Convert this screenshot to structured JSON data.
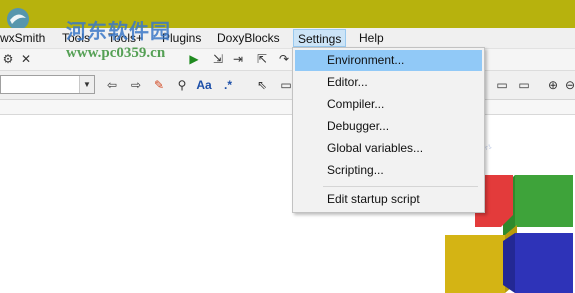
{
  "watermark": {
    "text": "河东软件园",
    "url": "www.pc0359.cn"
  },
  "menubar": {
    "items": [
      {
        "label": "wxSmith"
      },
      {
        "label": "Tools"
      },
      {
        "label": "Tools+"
      },
      {
        "label": "Plugins"
      },
      {
        "label": "DoxyBlocks"
      },
      {
        "label": "Settings"
      },
      {
        "label": "Help"
      }
    ]
  },
  "settings_menu": {
    "items": [
      {
        "label": "Environment..."
      },
      {
        "label": "Editor..."
      },
      {
        "label": "Compiler..."
      },
      {
        "label": "Debugger..."
      },
      {
        "label": "Global variables..."
      },
      {
        "label": "Scripting..."
      },
      {
        "label": "Edit startup script"
      }
    ],
    "highlighted_index": 0
  },
  "toolbar": {
    "icons": [
      "back-arrow-icon",
      "forward-arrow-icon",
      "highlight-pen-icon",
      "spellcheck-icon",
      "match-case-icon",
      "regex-icon",
      "select-icon",
      "rectangle-icon",
      "zoom-in-icon"
    ],
    "text_match_case": "Aa",
    "text_regex": ".*"
  },
  "colors": {
    "title_bar": "#b7b20d",
    "menu_highlight": "#91c9f7",
    "cube_red": "#e33b3b",
    "cube_green": "#3ea33a",
    "cube_yellow": "#d4b414",
    "cube_blue": "#2e33b8"
  }
}
